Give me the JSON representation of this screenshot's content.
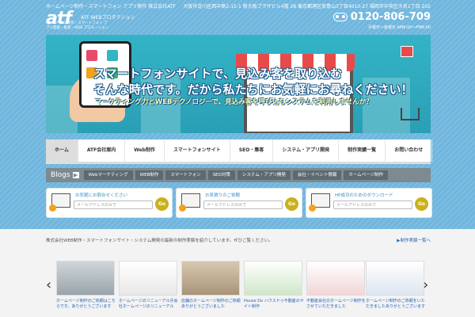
{
  "header": {
    "company": "ホームページ制作・スマートフォン アプリ制作 株式会社ATF",
    "logo": "atf",
    "logo_sub": "ATF WEBプロダクション",
    "tagline": "ホームページ制作・スマートフォン アプリ開発・集客・WEB プロモーション",
    "address": "大阪市淀川区西中島2-15-1 新大阪プラザビル4階 28 東京都港区南青山3丁目4010-27 福岡市中央区大名1丁目 202",
    "phone": "0120-806-709",
    "hours": "月曜日〜金曜日 AM9:00〜PM6:00"
  },
  "hero": {
    "line1": "スマートフォンサイトで、見込み客を取り込む",
    "line2": "そんな時代です。だから私たちにお気軽にお尋ねください！",
    "line3": "マーケティング力とWEBテクノロジーで、見込み客を呼び込むシステムを利用しませんか？"
  },
  "nav": {
    "items": [
      "ホーム",
      "ATF会社案内",
      "Web制作",
      "スマートフォンサイト",
      "SEO・集客",
      "システム・アプリ開発",
      "制作実績一覧",
      "お問い合わせ"
    ]
  },
  "blogs": {
    "label": "Blogs",
    "tabs": [
      "Webマーケティング",
      "WEB制作",
      "スマートフォン",
      "SEO対策",
      "システム・アプリ開発",
      "会社・イベント情報",
      "ホームページ制作"
    ]
  },
  "forms": [
    {
      "title": "お気軽にお問合せください",
      "placeholder": "メールアドレスのみで",
      "button": "Go"
    },
    {
      "title": "お見積りのご依頼",
      "placeholder": "メールアドレスのみで",
      "button": "Go"
    },
    {
      "title": "HP成功のためのダウンロード",
      "placeholder": "メールアドレスのみで",
      "button": "Go"
    }
  ],
  "news": {
    "text": "株式会社WEB制作・スマートフォンサイト・システム開発の最新の制作実績を紹介しています。ぜひご覧ください。",
    "link": "▶制作実績一覧へ",
    "items": [
      {
        "caption": "ホームページ制作のご依頼はこちらです。ありがとうございます"
      },
      {
        "caption": "ホームページのリニューアル＠会社ホームページのリニューアル"
      },
      {
        "caption": "店舗のホームページ制作のご依頼ありがとうございました"
      },
      {
        "caption": "House Do ハウスドゥ不動産のサイト制作"
      },
      {
        "caption": "不動産会社のホームページ制作をさせていただきました"
      },
      {
        "caption": "ホームページ制作のご依頼をいただきましたありがとうございます"
      }
    ]
  },
  "colors": {
    "accent": "#2763b8",
    "go_button": "#c9b11a",
    "hero_bg": "#34b3c6"
  }
}
